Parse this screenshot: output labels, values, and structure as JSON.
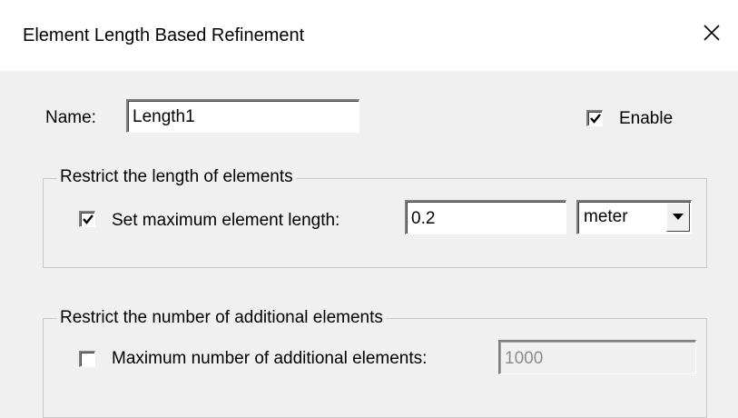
{
  "dialog": {
    "title": "Element Length Based Refinement",
    "close_icon": "close-icon"
  },
  "name_row": {
    "label": "Name:",
    "value": "Length1",
    "enable_label": "Enable",
    "enable_checked": true
  },
  "group_length": {
    "title": "Restrict the length of elements",
    "checkbox_label": "Set maximum element length:",
    "checked": true,
    "value": "0.2",
    "unit_selected": "meter",
    "dropdown_icon": "chevron-down-icon"
  },
  "group_count": {
    "title": "Restrict the number of additional elements",
    "checkbox_label": "Maximum number of additional elements:",
    "checked": false,
    "value": "1000",
    "value_disabled": true
  },
  "colors": {
    "background": "#f0f0f0",
    "titlebar": "#ffffff",
    "disabled_text": "#8c8c8c"
  }
}
